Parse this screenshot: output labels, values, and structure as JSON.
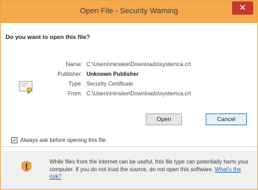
{
  "window": {
    "title": "Open File - Security Warning",
    "close_glyph": "✕"
  },
  "dialog": {
    "question": "Do you want to open this file?",
    "icon": "certificate-icon",
    "fields": [
      {
        "label": "Name:",
        "value": "C:\\Users\\minslee\\Downloads\\systemca.crt"
      },
      {
        "label": "Publisher:",
        "value": "Unknown Publisher"
      },
      {
        "label": "Type:",
        "value": "Security Certificate"
      },
      {
        "label": "From:",
        "value": "C:\\Users\\minslee\\Downloads\\systemca.crt"
      }
    ],
    "buttons": {
      "open": "Open",
      "cancel": "Cancel"
    }
  },
  "checkbox": {
    "checked": true,
    "label": "Always ask before opening this file"
  },
  "footer": {
    "icon": "shield-warning-icon",
    "text": "While files from the Internet can be useful, this file type can potentially harm your computer. If you do not trust the source, do not open this software.",
    "link": "What's the risk?"
  },
  "colors": {
    "titlebar": "#f6a94a",
    "close": "#c7392c",
    "link": "#1c64b8"
  }
}
